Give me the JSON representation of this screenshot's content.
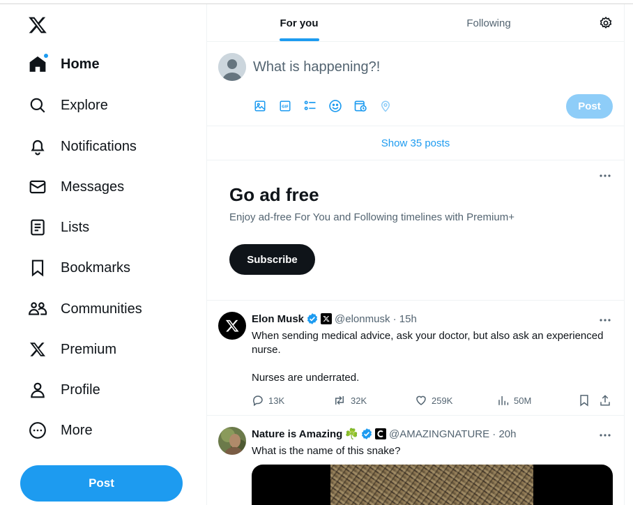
{
  "colors": {
    "accent": "#1d9bf0",
    "text": "#0f1419",
    "muted": "#536471",
    "post_disabled": "#8ecdf8"
  },
  "sidebar": {
    "logo_icon": "x-logo-icon",
    "items": [
      {
        "label": "Home",
        "icon": "home-icon",
        "active": true
      },
      {
        "label": "Explore",
        "icon": "search-icon"
      },
      {
        "label": "Notifications",
        "icon": "bell-icon"
      },
      {
        "label": "Messages",
        "icon": "envelope-icon"
      },
      {
        "label": "Lists",
        "icon": "list-icon"
      },
      {
        "label": "Bookmarks",
        "icon": "bookmark-icon"
      },
      {
        "label": "Communities",
        "icon": "people-icon"
      },
      {
        "label": "Premium",
        "icon": "x-logo-icon"
      },
      {
        "label": "Profile",
        "icon": "user-icon"
      },
      {
        "label": "More",
        "icon": "more-circle-icon"
      }
    ],
    "post_label": "Post"
  },
  "tabs": [
    {
      "label": "For you",
      "active": true
    },
    {
      "label": "Following"
    }
  ],
  "composer": {
    "placeholder": "What is happening?!",
    "icons": [
      "image-icon",
      "gif-icon",
      "poll-icon",
      "emoji-icon",
      "schedule-icon",
      "location-icon"
    ],
    "post_label": "Post"
  },
  "show_posts": "Show 35 posts",
  "ad": {
    "title": "Go ad free",
    "subtitle": "Enjoy ad-free For You and Following timelines with Premium+",
    "button": "Subscribe"
  },
  "tweets": [
    {
      "name": "Elon Musk",
      "handle": "@elonmusk · 15h",
      "text_line1": "When sending medical advice, ask your doctor, but also ask an experienced",
      "text_line2": "nurse.",
      "text_line3": "Nurses are underrated.",
      "replies": "13K",
      "reposts": "32K",
      "likes": "259K",
      "views": "50M"
    },
    {
      "name": "Nature is Amazing",
      "emoji": "☘️",
      "handle": "@AMAZINGNATURE · 20h",
      "text": "What is the name of this snake?"
    }
  ]
}
